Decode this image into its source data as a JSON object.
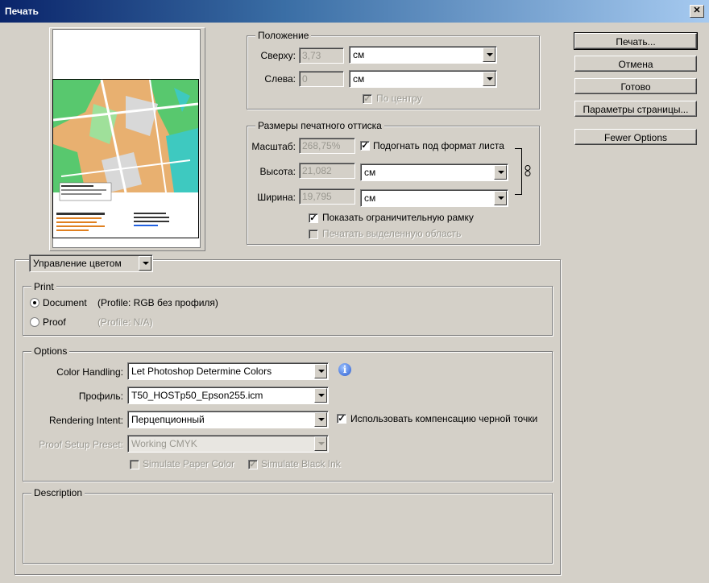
{
  "window": {
    "title": "Печать",
    "close_glyph": "✕"
  },
  "buttons": {
    "print": "Печать...",
    "cancel": "Отмена",
    "done": "Готово",
    "page_setup": "Параметры страницы...",
    "fewer_options": "Fewer Options"
  },
  "position": {
    "legend": "Положение",
    "top_label": "Сверху:",
    "top_value": "3,73",
    "top_unit": "см",
    "left_label": "Слева:",
    "left_value": "0",
    "left_unit": "см",
    "center_label": "По центру"
  },
  "print_size": {
    "legend": "Размеры печатного оттиска",
    "scale_label": "Масштаб:",
    "scale_value": "268,75%",
    "fit_label": "Подогнать под формат листа",
    "height_label": "Высота:",
    "height_value": "21,082",
    "height_unit": "см",
    "width_label": "Ширина:",
    "width_value": "19,795",
    "width_unit": "см",
    "bounding_label": "Показать ограничительную рамку",
    "selected_area_label": "Печатать выделенную область"
  },
  "mode_select": {
    "value": "Управление цветом"
  },
  "print_group": {
    "legend": "Print",
    "document_label": "Document",
    "document_profile": "(Profile: RGB без профиля)",
    "proof_label": "Proof",
    "proof_profile": "(Profile: N/A)"
  },
  "options_group": {
    "legend": "Options",
    "color_handling_label": "Color Handling:",
    "color_handling_value": "Let Photoshop Determine Colors",
    "profile_label": "Профиль:",
    "profile_value": "T50_HOSTp50_Epson255.icm",
    "rendering_label": "Rendering Intent:",
    "rendering_value": "Перцепционный",
    "bpc_label": "Использовать компенсацию черной точки",
    "proof_preset_label": "Proof Setup Preset:",
    "proof_preset_value": "Working CMYK",
    "simulate_paper_label": "Simulate Paper Color",
    "simulate_ink_label": "Simulate Black Ink"
  },
  "description_group": {
    "legend": "Description"
  },
  "colors": {
    "titlebar_start": "#0a246a",
    "titlebar_end": "#a6caf0",
    "face": "#d4d0c8",
    "map_green": "#58c86e",
    "map_orange": "#e8b070",
    "map_sea": "#3ec9c0"
  }
}
